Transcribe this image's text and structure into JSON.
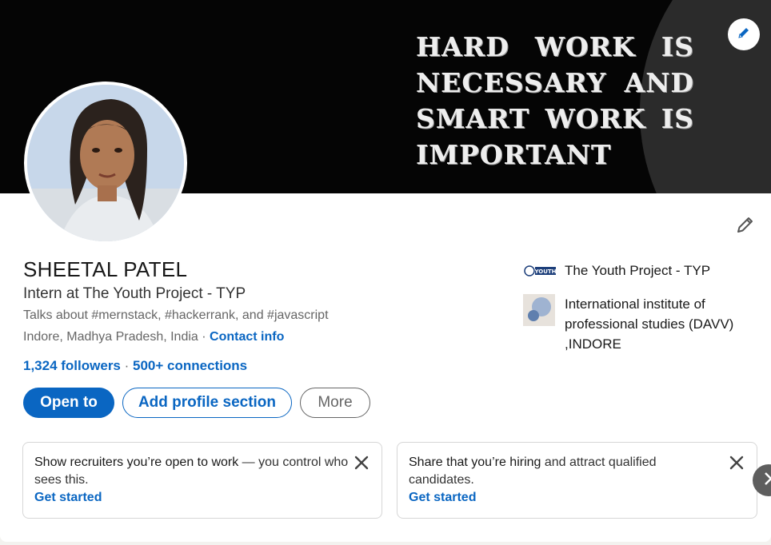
{
  "banner": {
    "quote": "HARD WORK IS NECESSARY AND SMART WORK IS IMPORTANT"
  },
  "profile": {
    "name": "SHEETAL PATEL",
    "headline": "Intern at The Youth Project - TYP",
    "talks_about": "Talks about #mernstack, #hackerrank, and #javascript",
    "location": "Indore, Madhya Pradesh, India",
    "location_separator": " · ",
    "contact_info": "Contact info",
    "followers": "1,324 followers",
    "connections_separator": " · ",
    "connections": "500+ connections"
  },
  "actions": {
    "open_to": "Open to",
    "add_section": "Add profile section",
    "more": "More"
  },
  "experience": [
    {
      "label": "The Youth Project - TYP",
      "logo": "youth-project-logo"
    },
    {
      "label": "International institute of professional studies (DAVV) ,INDORE",
      "logo": "institute-logo"
    }
  ],
  "suggestions": [
    {
      "bold": "Show recruiters you’re open to work",
      "rest": " — you control who sees this.",
      "cta": "Get started"
    },
    {
      "bold": "Share that you’re hiring",
      "rest": " and attract qualified candidates.",
      "cta": "Get started"
    }
  ],
  "colors": {
    "accent": "#0a66c2",
    "banner": "#050505",
    "page_bg": "#f3f2ef"
  },
  "icons": [
    "pencil-icon",
    "close-icon",
    "chevron-right-icon"
  ]
}
